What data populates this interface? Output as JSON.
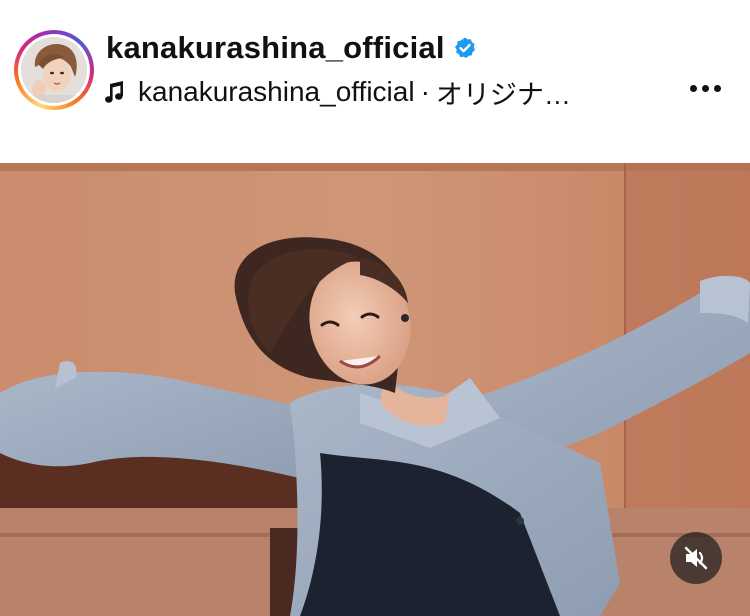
{
  "header": {
    "username": "kanakurashina_official",
    "verified": true,
    "audio": {
      "user": "kanakurashina_official",
      "separator": "·",
      "track": "オリジナ…"
    },
    "more_icon": "more-horizontal-icon"
  },
  "media": {
    "type": "video",
    "mute_icon": "speaker-muted-icon"
  },
  "colors": {
    "verified": "#1d9bf0",
    "ring_start": "#feda75",
    "ring_end": "#962fbf",
    "wall": "#c88766"
  }
}
